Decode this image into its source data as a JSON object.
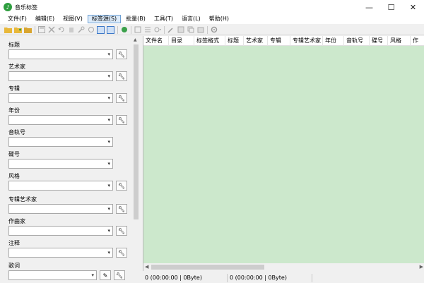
{
  "window": {
    "title": "音乐标签",
    "icon_name": "music-tag-app-icon",
    "accent": "#2e9e3f",
    "controls": [
      "—",
      "☐",
      "✕"
    ]
  },
  "menu": [
    {
      "label": "文件(F)"
    },
    {
      "label": "编辑(E)"
    },
    {
      "label": "视图(V)"
    },
    {
      "label": "标签源(S)"
    },
    {
      "label": "批量(B)"
    },
    {
      "label": "工具(T)"
    },
    {
      "label": "语言(L)"
    },
    {
      "label": "帮助(H)"
    }
  ],
  "toolbar_icons": [
    "open-folder-icon",
    "add-folder-icon",
    "folder-icon",
    "save-icon",
    "remove-icon",
    "undo-icon",
    "delete-icon",
    "wrench-icon",
    "refresh-icon",
    "view-list-icon",
    "view-detail-icon",
    "tag-source-icon",
    "batch-icon",
    "batch-list-icon",
    "batch-dropdown-icon",
    "tool-icon",
    "convert-icon",
    "copy-icon",
    "paste-icon",
    "settings-icon"
  ],
  "fields": [
    {
      "label": "标题"
    },
    {
      "label": "艺术家"
    },
    {
      "label": "专辑"
    },
    {
      "label": "年份"
    },
    {
      "label": "音轨号"
    },
    {
      "label": "碟号"
    },
    {
      "label": "风格"
    },
    {
      "label": "专辑艺术家"
    },
    {
      "label": "作曲家"
    },
    {
      "label": "注释"
    },
    {
      "label": "歌词"
    }
  ],
  "columns": [
    "文件名",
    "目录",
    "标签格式",
    "标题",
    "艺术家",
    "专辑",
    "专辑艺术家",
    "年份",
    "音轨号",
    "碟号",
    "风格",
    "作"
  ],
  "list_bg": "#cce8cc",
  "status": [
    "0 (00:00:00 | 0Byte)",
    "0 (00:00:00 | 0Byte)"
  ]
}
